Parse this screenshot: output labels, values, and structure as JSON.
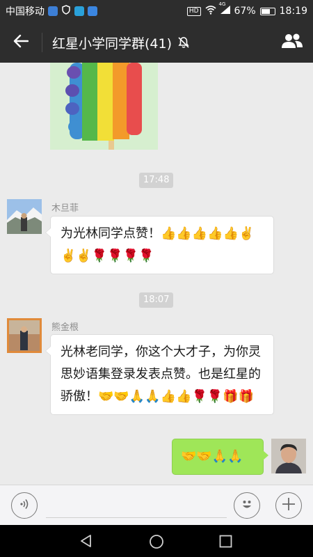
{
  "status_bar": {
    "carrier": "中国移动",
    "network": "4G",
    "battery": "67%",
    "battery_level": 0.67,
    "time": "18:19",
    "icons": [
      "hd-icon",
      "wifi-icon",
      "signal-icon",
      "battery-icon"
    ]
  },
  "header": {
    "title": "红星小学同学群(41)",
    "back_icon": "back-arrow-icon",
    "mute_icon": "mute-bell-icon",
    "members_icon": "group-members-icon"
  },
  "messages": [
    {
      "type": "sticker",
      "description": "rainbow popsicle",
      "sender_side": "left"
    },
    {
      "type": "timestamp",
      "text": "17:48"
    },
    {
      "type": "text",
      "sender": "木旦菲",
      "side": "left",
      "text": "为光林同学点赞！👍👍👍👍👍✌️✌️✌️🌹🌹🌹🌹"
    },
    {
      "type": "timestamp",
      "text": "18:07"
    },
    {
      "type": "text",
      "sender": "熊金根",
      "side": "left",
      "text": "光林老同学，你这个大才子，为你灵思妙语集登录发表点赞。也是红星的骄傲！🤝🤝🙏🙏👍👍🌹🌹🎁🎁"
    },
    {
      "type": "text",
      "sender": "",
      "side": "right",
      "text": "🤝🤝🙏🙏"
    }
  ],
  "input_bar": {
    "voice_icon": "voice-icon",
    "emoji_icon": "emoji-icon",
    "plus_icon": "plus-icon"
  },
  "colors": {
    "header_bg": "#2d2d2d",
    "chat_bg": "#ebebeb",
    "my_bubble": "#9fe658",
    "other_bubble": "#ffffff"
  }
}
